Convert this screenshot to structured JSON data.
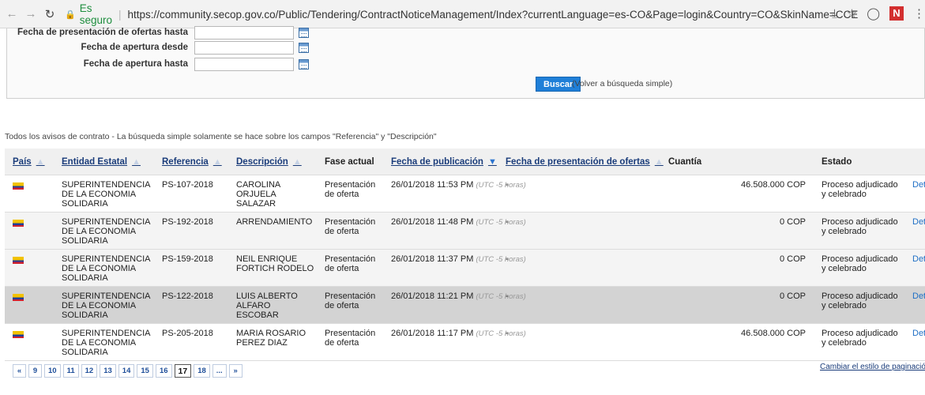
{
  "browser": {
    "secure_label": "Es seguro",
    "separator": "|",
    "url": "https://community.secop.gov.co/Public/Tendering/ContractNoticeManagement/Index?currentLanguage=es-CO&Page=login&Country=CO&SkinName=CCE",
    "badge": "N"
  },
  "search": {
    "rows": [
      {
        "label": "Fecha de presentación de ofertas hasta"
      },
      {
        "label": "Fecha de apertura desde"
      },
      {
        "label": "Fecha de apertura hasta"
      }
    ],
    "search_button": "Buscar",
    "simple_link": "(Volver a búsqueda simple)"
  },
  "notice_text": "Todos los avisos de contrato - La búsqueda simple solamente se hace sobre los campos \"Referencia\" y \"Descripción\"",
  "table": {
    "headers": {
      "pais": "País",
      "entidad": "Entidad Estatal",
      "referencia": "Referencia",
      "descripcion": "Descripción",
      "fase": "Fase actual",
      "fecha_pub": "Fecha de publicación",
      "fecha_pres": "Fecha de presentación de ofertas",
      "cuantia": "Cuantía",
      "estado": "Estado"
    },
    "rows": [
      {
        "entidad": "SUPERINTENDENCIA DE LA ECONOMIA SOLIDARIA",
        "referencia": "PS-107-2018",
        "descripcion": "CAROLINA ORJUELA SALAZAR",
        "fase": "Presentación de oferta",
        "fecha": "26/01/2018 11:53 PM",
        "utc": "(UTC -5 horas)",
        "presentacion": "-",
        "cuantia": "46.508.000 COP",
        "estado": "Proceso adjudicado y celebrado",
        "det": "Det"
      },
      {
        "entidad": "SUPERINTENDENCIA DE LA ECONOMIA SOLIDARIA",
        "referencia": "PS-192-2018",
        "descripcion": "ARRENDAMIENTO",
        "fase": "Presentación de oferta",
        "fecha": "26/01/2018 11:48 PM",
        "utc": "(UTC -5 horas)",
        "presentacion": "-",
        "cuantia": "0 COP",
        "estado": "Proceso adjudicado y celebrado",
        "det": "Det"
      },
      {
        "entidad": "SUPERINTENDENCIA DE LA ECONOMIA SOLIDARIA",
        "referencia": "PS-159-2018",
        "descripcion": "NEIL ENRIQUE FORTICH RODELO",
        "fase": "Presentación de oferta",
        "fecha": "26/01/2018 11:37 PM",
        "utc": "(UTC -5 horas)",
        "presentacion": "-",
        "cuantia": "0 COP",
        "estado": "Proceso adjudicado y celebrado",
        "det": "Det"
      },
      {
        "entidad": "SUPERINTENDENCIA DE LA ECONOMIA SOLIDARIA",
        "referencia": "PS-122-2018",
        "descripcion": "LUIS ALBERTO ALFARO ESCOBAR",
        "fase": "Presentación de oferta",
        "fecha": "26/01/2018 11:21 PM",
        "utc": "(UTC -5 horas)",
        "presentacion": "-",
        "cuantia": "0 COP",
        "estado": "Proceso adjudicado y celebrado",
        "det": "Det"
      },
      {
        "entidad": "SUPERINTENDENCIA DE LA ECONOMIA SOLIDARIA",
        "referencia": "PS-205-2018",
        "descripcion": "MARIA ROSARIO PEREZ DIAZ",
        "fase": "Presentación de oferta",
        "fecha": "26/01/2018 11:17 PM",
        "utc": "(UTC -5 horas)",
        "presentacion": "-",
        "cuantia": "46.508.000 COP",
        "estado": "Proceso adjudicado y celebrado",
        "det": "Det"
      }
    ]
  },
  "pagination": {
    "first": "«",
    "pages": [
      "9",
      "10",
      "11",
      "12",
      "13",
      "14",
      "15",
      "16",
      "17",
      "18",
      "..."
    ],
    "current": "17",
    "next": "»",
    "style_link": "Cambiar el estilo de paginación"
  }
}
